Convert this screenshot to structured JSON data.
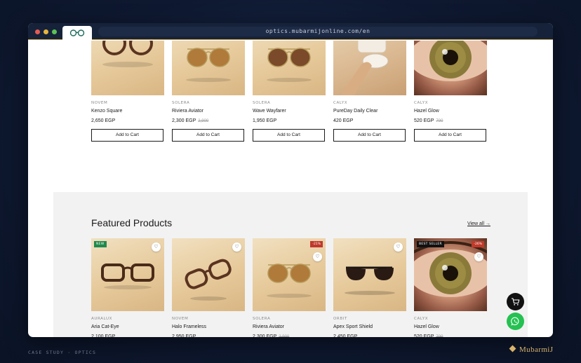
{
  "browser": {
    "url": "optics.mubarmijonline.com/en",
    "tab_icon": "glasses-icon"
  },
  "top_row": [
    {
      "brand": "NOVEM",
      "name": "Kenzo Square",
      "price": "2,650 EGP",
      "old_price": "",
      "image": "round-glasses",
      "button": "Add to Cart"
    },
    {
      "brand": "SOLERA",
      "name": "Riviera Aviator",
      "price": "2,300 EGP",
      "old_price": "2,900",
      "image": "aviator",
      "button": "Add to Cart"
    },
    {
      "brand": "SOLERA",
      "name": "Wave Wayfarer",
      "price": "1,950 EGP",
      "old_price": "",
      "image": "aviator-brown",
      "button": "Add to Cart"
    },
    {
      "brand": "CALYX",
      "name": "PureDay Daily Clear",
      "price": "420 EGP",
      "old_price": "",
      "image": "contact-lens",
      "button": "Add to Cart"
    },
    {
      "brand": "CALYX",
      "name": "Hazel Glow",
      "price": "520 EGP",
      "old_price": "700",
      "image": "eye",
      "button": "Add to Cart"
    }
  ],
  "featured": {
    "title": "Featured Products",
    "view_all": "View all →",
    "items": [
      {
        "brand": "AURALUX",
        "name": "Aria Cat-Eye",
        "price": "2,100 EGP",
        "old_price": "",
        "badge_left": "NEW",
        "badge_left_color": "#1f8a4c",
        "badge_right": "",
        "image": "square-glasses",
        "button": "Add to Cart"
      },
      {
        "brand": "NOVEM",
        "name": "Halo Frameless",
        "price": "2,950 EGP",
        "old_price": "",
        "badge_left": "",
        "badge_left_color": "",
        "badge_right": "",
        "image": "tilted-glasses",
        "button": "Add to Cart"
      },
      {
        "brand": "SOLERA",
        "name": "Riviera Aviator",
        "price": "2,300 EGP",
        "old_price": "2,900",
        "badge_left": "",
        "badge_left_color": "",
        "badge_right": "-21%",
        "image": "aviator",
        "button": "Add to Cart"
      },
      {
        "brand": "ORBIT",
        "name": "Apex Sport Shield",
        "price": "2,450 EGP",
        "old_price": "",
        "badge_left": "",
        "badge_left_color": "",
        "badge_right": "",
        "image": "sunglasses",
        "button": "Add to Cart"
      },
      {
        "brand": "CALYX",
        "name": "Hazel Glow",
        "price": "520 EGP",
        "old_price": "700",
        "badge_left": "BEST SELLER",
        "badge_left_color": "#111111",
        "badge_right": "-26%",
        "image": "eye",
        "button": "Add to Cart"
      }
    ]
  },
  "floating": {
    "cart_icon": "cart-icon",
    "whatsapp_icon": "whatsapp-icon"
  },
  "footer": {
    "left": "CASE STUDY · OPTICS",
    "logo": "MubarmiJ"
  },
  "colors": {
    "accent_gold": "#d9b36b",
    "sale_red": "#c0392b",
    "new_green": "#1f8a4c",
    "whatsapp": "#25c152"
  }
}
